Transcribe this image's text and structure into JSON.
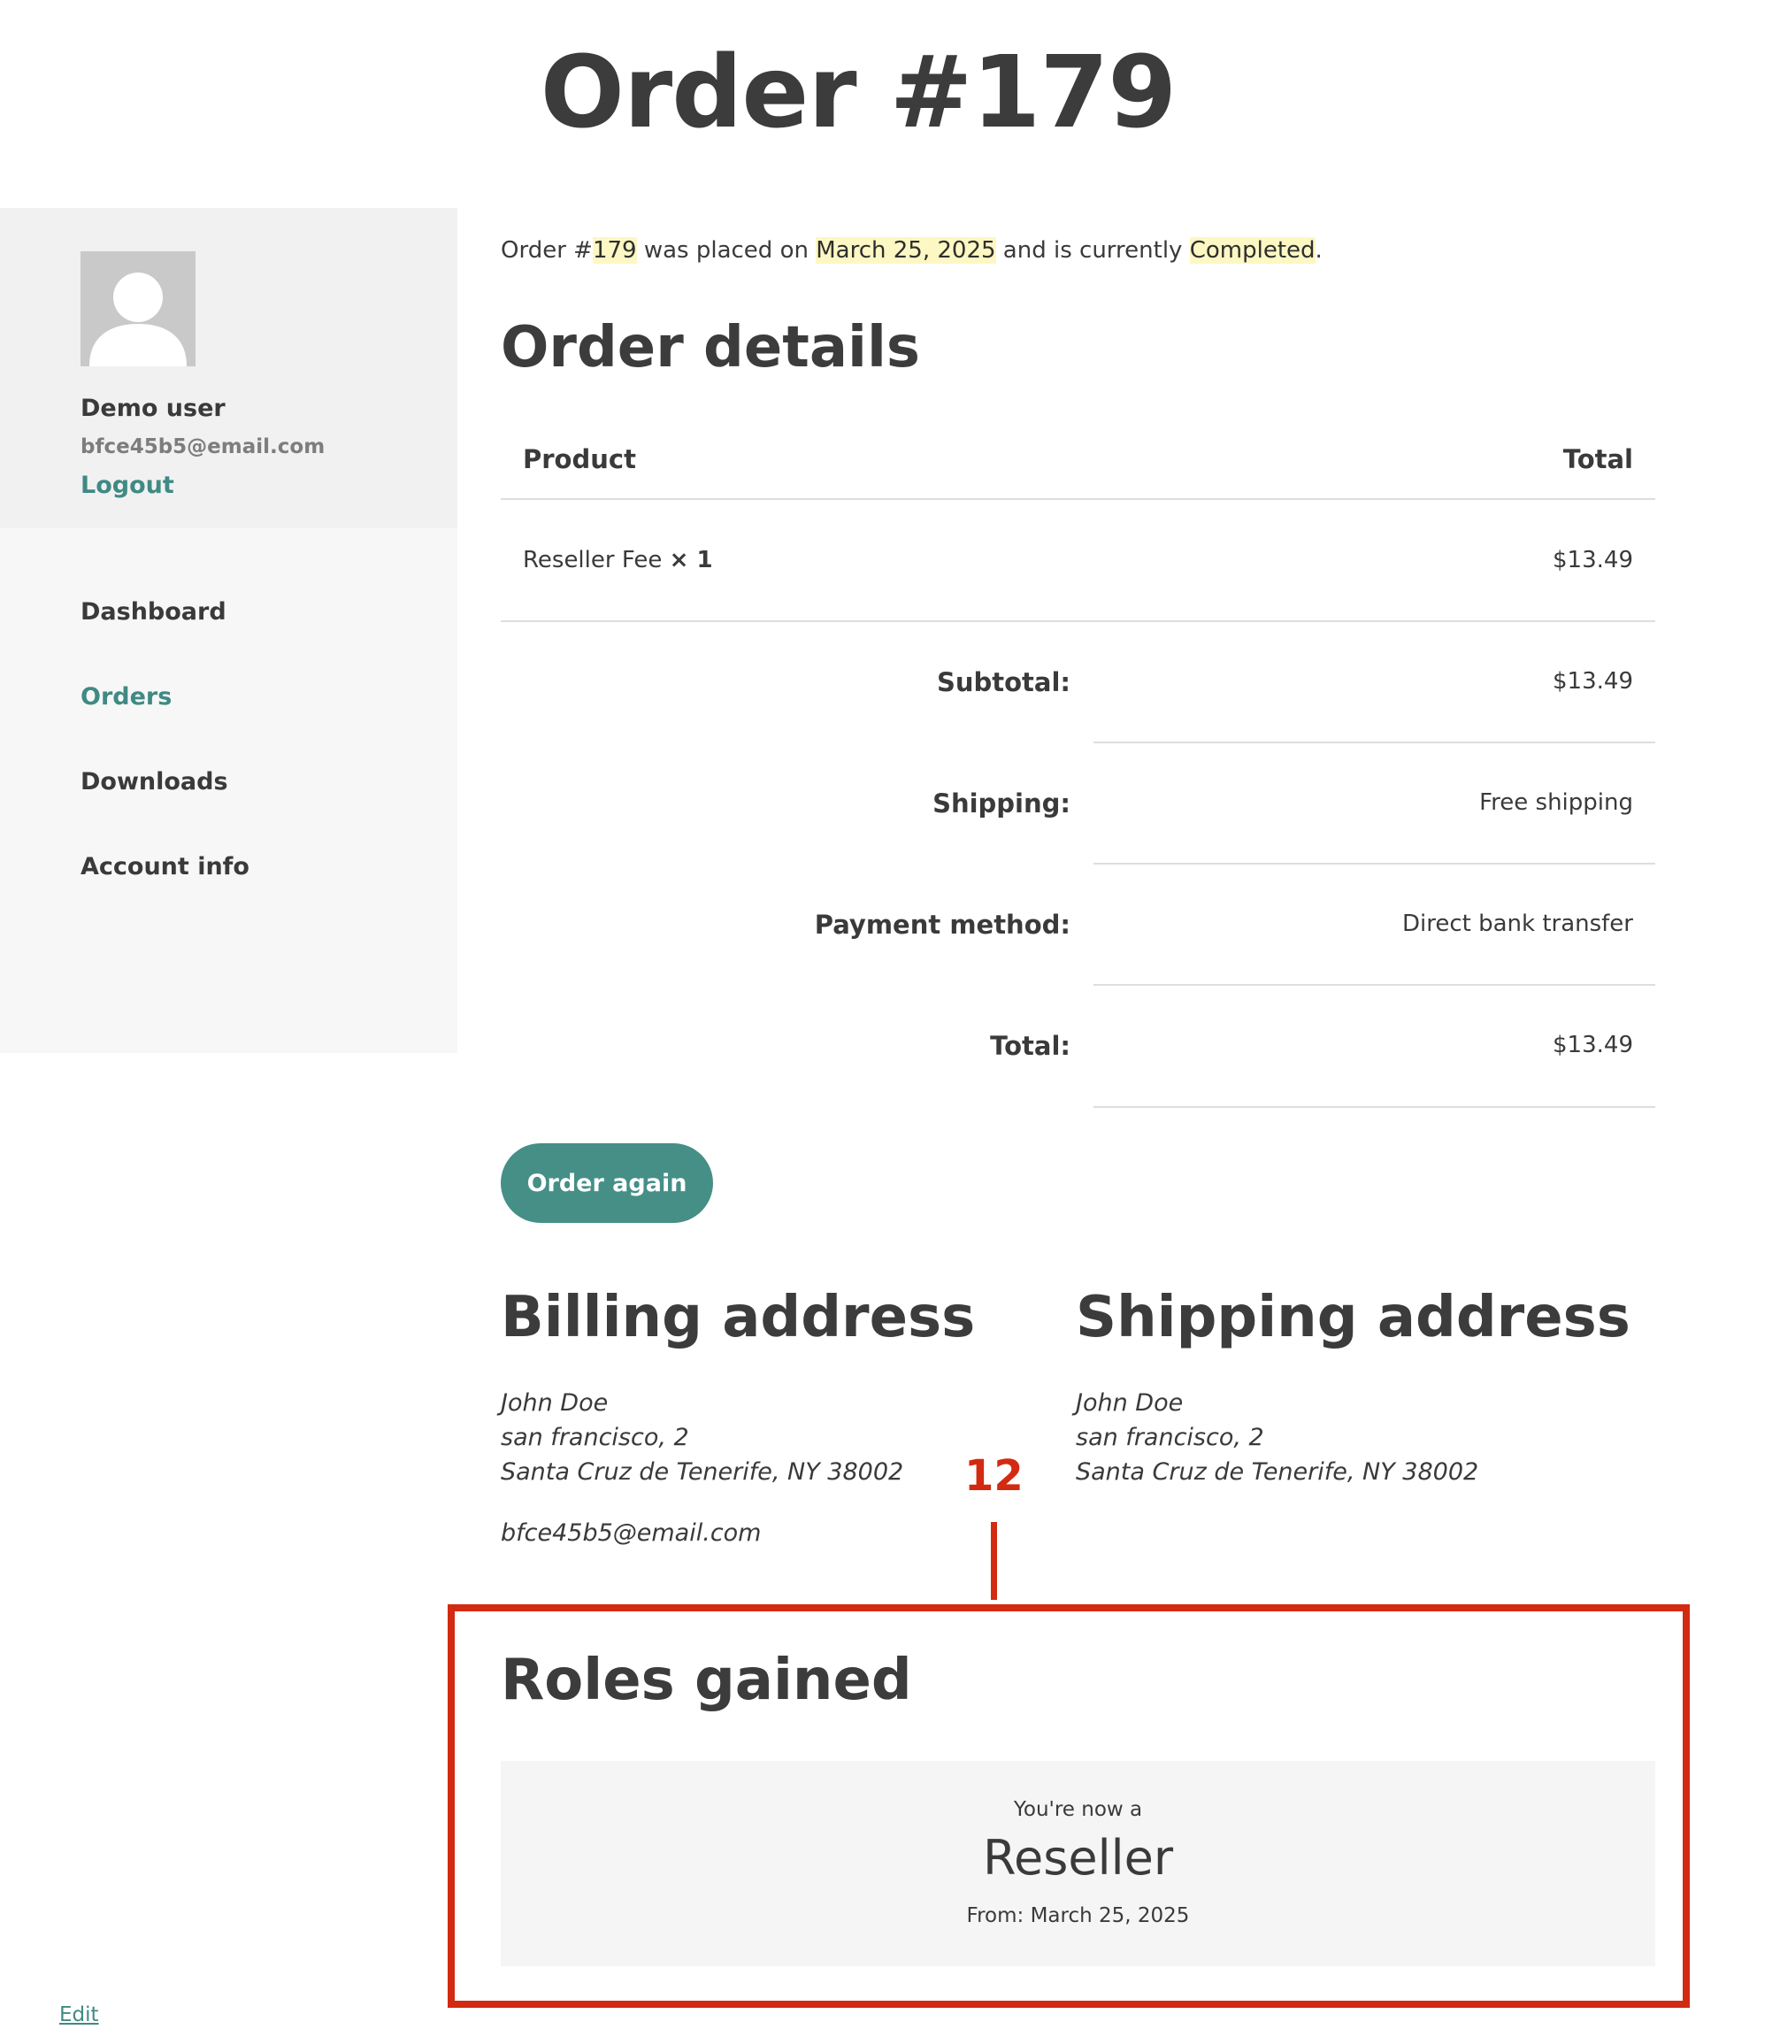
{
  "page": {
    "title": "Order #179"
  },
  "sidebar": {
    "user_name": "Demo user",
    "user_email": "bfce45b5@email.com",
    "logout_label": "Logout",
    "nav": [
      {
        "label": "Dashboard",
        "active": false
      },
      {
        "label": "Orders",
        "active": true
      },
      {
        "label": "Downloads",
        "active": false
      },
      {
        "label": "Account info",
        "active": false
      }
    ]
  },
  "intro": {
    "prefix": "Order #",
    "order_number": "179",
    "placed_text": " was placed on ",
    "date": "March 25, 2025",
    "status_text": " and is currently ",
    "status": "Completed",
    "suffix": "."
  },
  "order_details": {
    "heading": "Order details",
    "col_product": "Product",
    "col_total": "Total",
    "item": {
      "name": "Reseller Fee",
      "qty": "× 1",
      "total": "$13.49"
    },
    "totals": [
      {
        "label": "Subtotal:",
        "value": "$13.49"
      },
      {
        "label": "Shipping:",
        "value": "Free shipping"
      },
      {
        "label": "Payment method:",
        "value": "Direct bank transfer"
      },
      {
        "label": "Total:",
        "value": "$13.49"
      }
    ],
    "order_again_label": "Order again"
  },
  "billing": {
    "heading": "Billing address",
    "lines": [
      "John Doe",
      "san francisco, 2",
      "Santa Cruz de Tenerife, NY 38002"
    ],
    "email": "bfce45b5@email.com"
  },
  "shipping": {
    "heading": "Shipping address",
    "lines": [
      "John Doe",
      "san francisco, 2",
      "Santa Cruz de Tenerife, NY 38002"
    ]
  },
  "annotation": {
    "number": "12",
    "color": "#d32a12"
  },
  "roles": {
    "heading": "Roles gained",
    "now_text": "You're now a",
    "role": "Reseller",
    "from_text": "From: March 25, 2025"
  },
  "footer": {
    "edit_label": "Edit"
  },
  "colors": {
    "accent": "#458f87",
    "highlight": "#fdf7c3",
    "text": "#3a3a3a"
  }
}
